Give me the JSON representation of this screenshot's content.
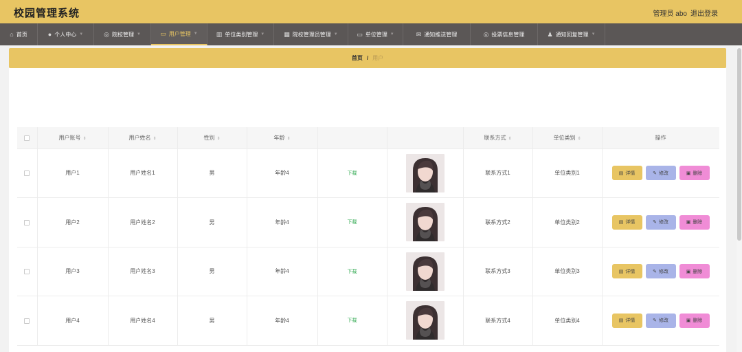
{
  "header": {
    "title": "校园管理系统",
    "admin_label": "管理员 abo",
    "logout_label": "退出登录"
  },
  "nav": {
    "items": [
      {
        "label": "首页",
        "icon": "home-icon",
        "active": false
      },
      {
        "label": "个人中心",
        "icon": "user-icon",
        "active": false
      },
      {
        "label": "院校管理",
        "icon": "compass-icon",
        "active": false
      },
      {
        "label": "用户管理",
        "icon": "monitor-icon",
        "active": true
      },
      {
        "label": "单位类别管理",
        "icon": "bar-chart-icon",
        "active": false
      },
      {
        "label": "院校管理员管理",
        "icon": "building-icon",
        "active": false
      },
      {
        "label": "单位管理",
        "icon": "monitor-icon",
        "active": false
      },
      {
        "label": "通知推送管理",
        "icon": "mail-icon",
        "active": false
      },
      {
        "label": "投票信息管理",
        "icon": "compass-icon",
        "active": false
      },
      {
        "label": "通知回复管理",
        "icon": "people-icon",
        "active": false
      }
    ]
  },
  "breadcrumb": {
    "home": "首页",
    "separator": "/",
    "current": "用户"
  },
  "table": {
    "headers": {
      "account": "用户账号",
      "name": "用户姓名",
      "gender": "性别",
      "age": "年龄",
      "contact": "联系方式",
      "category": "单位类别",
      "actions": "操作"
    },
    "rows": [
      {
        "account": "用户1",
        "name": "用户姓名1",
        "gender": "男",
        "age": "年龄4",
        "file": "下载",
        "contact": "联系方式1",
        "category": "单位类别1"
      },
      {
        "account": "用户2",
        "name": "用户姓名2",
        "gender": "男",
        "age": "年龄4",
        "file": "下载",
        "contact": "联系方式2",
        "category": "单位类别2"
      },
      {
        "account": "用户3",
        "name": "用户姓名3",
        "gender": "男",
        "age": "年龄4",
        "file": "下载",
        "contact": "联系方式3",
        "category": "单位类别3"
      },
      {
        "account": "用户4",
        "name": "用户姓名4",
        "gender": "男",
        "age": "年龄4",
        "file": "下载",
        "contact": "联系方式4",
        "category": "单位类别4"
      }
    ],
    "actions": {
      "detail": "详情",
      "edit": "修改",
      "delete": "删除"
    }
  },
  "colors": {
    "accent": "#e8c563",
    "nav_bg": "#5b5756",
    "edit_button": "#a9b4e8",
    "delete_button": "#f08cd6",
    "download_link": "#2fa84f"
  }
}
